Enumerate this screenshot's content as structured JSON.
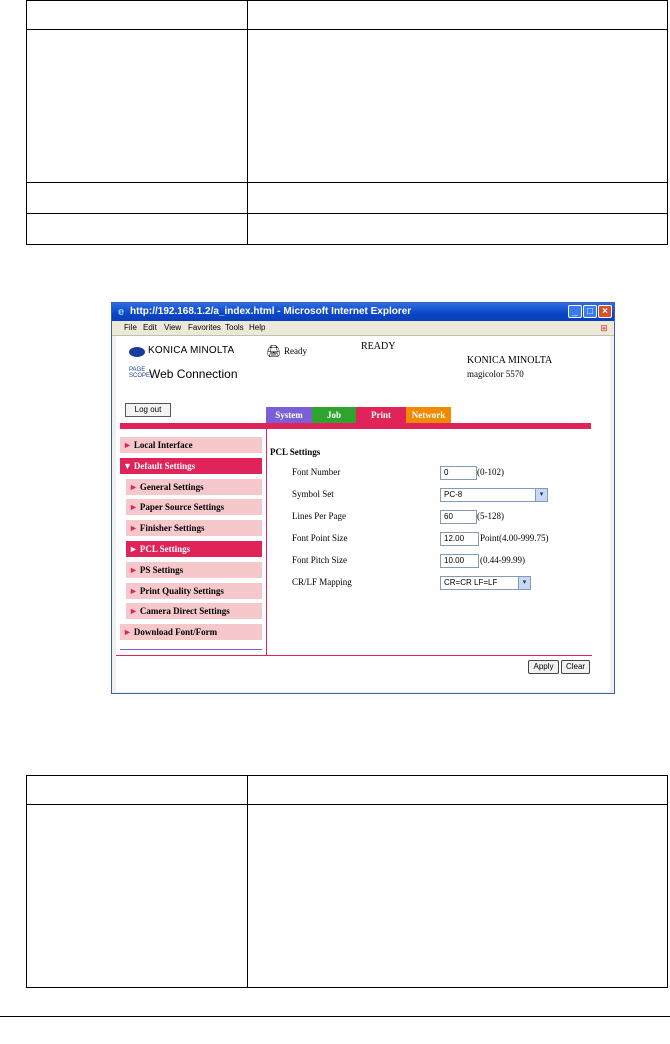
{
  "window": {
    "title": "http://192.168.1.2/a_index.html - Microsoft Internet Explorer",
    "controls": {
      "minimize": "_",
      "maximize": "□",
      "close": "×"
    }
  },
  "menu": [
    "File",
    "Edit",
    "View",
    "Favorites",
    "Tools",
    "Help"
  ],
  "header": {
    "logo_text": "KONICA MINOLTA",
    "pagescope_mark": "PAGE SCOPE",
    "web_connection": "Web Connection",
    "status_small": "Ready",
    "status_big": "READY",
    "brand": "KONICA MINOLTA",
    "model": "magicolor 5570",
    "logout": "Log out"
  },
  "tabs": [
    "System",
    "Job",
    "Print",
    "Network"
  ],
  "sidebar": [
    {
      "label": "Local Interface",
      "level": 1,
      "state": "normal",
      "arrow": "►"
    },
    {
      "label": "Default Settings",
      "level": 1,
      "state": "active",
      "arrow": "▼"
    },
    {
      "label": "General Settings",
      "level": 2,
      "state": "normal",
      "arrow": "►"
    },
    {
      "label": "Paper Source Settings",
      "level": 2,
      "state": "normal",
      "arrow": "►"
    },
    {
      "label": "Finisher Settings",
      "level": 2,
      "state": "normal",
      "arrow": "►"
    },
    {
      "label": "PCL Settings",
      "level": 2,
      "state": "active",
      "arrow": "►"
    },
    {
      "label": "PS Settings",
      "level": 2,
      "state": "normal",
      "arrow": "►"
    },
    {
      "label": "Print Quality Settings",
      "level": 2,
      "state": "normal",
      "arrow": "►"
    },
    {
      "label": "Camera Direct Settings",
      "level": 2,
      "state": "normal",
      "arrow": "►"
    },
    {
      "label": "Download Font/Form",
      "level": 1,
      "state": "normal",
      "arrow": "►"
    }
  ],
  "pcl": {
    "title": "PCL Settings",
    "font_number": {
      "label": "Font Number",
      "value": "0",
      "range": "(0-102)"
    },
    "symbol_set": {
      "label": "Symbol Set",
      "value": "PC-8"
    },
    "lines_per_page": {
      "label": "Lines Per Page",
      "value": "60",
      "range": "(5-128)"
    },
    "font_point_size": {
      "label": "Font Point Size",
      "value": "12.00",
      "range": "Point(4.00-999.75)"
    },
    "font_pitch_size": {
      "label": "Font Pitch Size",
      "value": "10.00",
      "range": "(0.44-99.99)"
    },
    "crlf_mapping": {
      "label": "CR/LF Mapping",
      "value": "CR=CR LF=LF"
    }
  },
  "buttons": {
    "apply": "Apply",
    "clear": "Clear"
  },
  "icons": {
    "dropdown": "▾",
    "printer": "🖨",
    "ie": "e",
    "winflag": "⊞"
  },
  "colors": {
    "accent": "#e0245a",
    "nav_bg": "#f6c8cc",
    "tab_system": "#7a5fd6",
    "tab_job": "#2ea42e",
    "tab_print": "#e0245a",
    "tab_network": "#f08a00",
    "titlebar": "#0b46c6"
  }
}
